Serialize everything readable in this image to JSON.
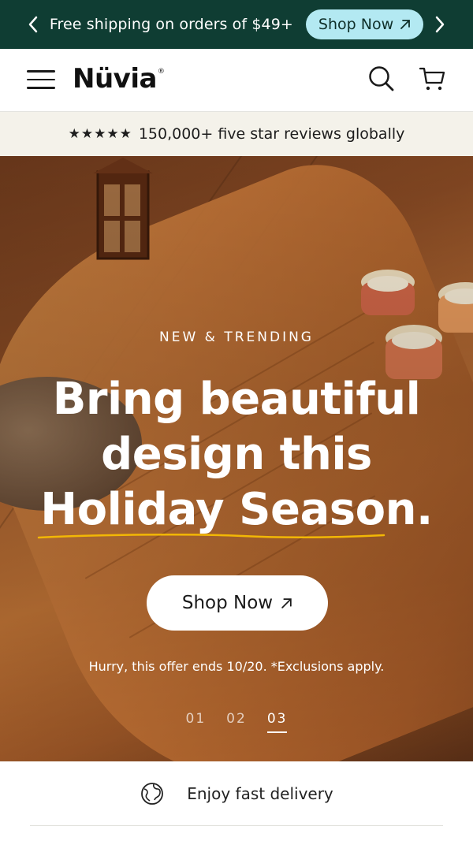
{
  "announcement": {
    "text": "Free shipping on orders of $49+",
    "button_label": "Shop Now"
  },
  "header": {
    "logo": "Nüvia",
    "logo_mark": "®"
  },
  "reviews": {
    "stars": "★★★★★",
    "text": "150,000+ five star reviews globally"
  },
  "hero": {
    "eyebrow": "NEW & TRENDING",
    "headline_line1": "Bring beautiful",
    "headline_line2": "design this",
    "headline_line3": "Holiday Season.",
    "button_label": "Shop Now",
    "offer_text": "Hurry, this offer ends 10/20. *Exclusions apply.",
    "slides": [
      "01",
      "02",
      "03"
    ],
    "active_slide": 3
  },
  "benefit": {
    "text": "Enjoy fast delivery"
  },
  "colors": {
    "announcement_bg": "#0f3d33",
    "announcement_button_bg": "#b3e9f2",
    "reviews_bg": "#f4f2ea",
    "underline_accent": "#f2b705"
  },
  "icons": {
    "announcement_prev": "chevron-left-icon",
    "announcement_next": "chevron-right-icon",
    "menu": "hamburger-menu-icon",
    "search": "search-icon",
    "cart": "cart-icon",
    "button_arrow": "arrow-up-right-icon",
    "benefit": "globe-icon"
  }
}
